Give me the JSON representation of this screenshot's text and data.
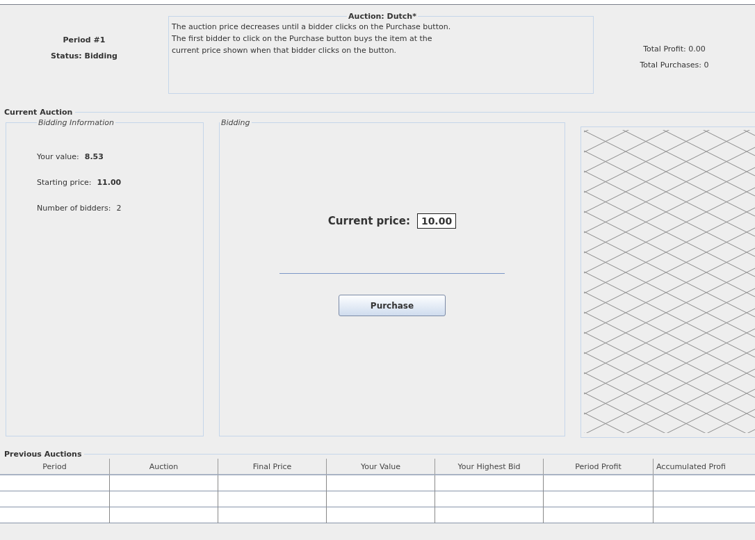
{
  "header": {
    "period": "Period #1",
    "status": "Status: Bidding"
  },
  "rules": {
    "title": "Auction: Dutch*",
    "text": "The auction price decreases until a bidder clicks on the Purchase button.\nThe first bidder to click on the Purchase button buys the item at the\ncurrent price shown when that bidder clicks on the button."
  },
  "totals": [
    "Total Profit: 0.00",
    "Total Purchases: 0"
  ],
  "current_auction": {
    "title": "Current Auction",
    "bidding_information": {
      "title": "Bidding Information",
      "items": [
        {
          "label": "Your value:",
          "value": "8.53",
          "bold": true
        },
        {
          "label": "Starting price:",
          "value": "11.00",
          "bold": true
        },
        {
          "label": "Number of bidders:",
          "value": "2",
          "bold": false
        }
      ]
    },
    "bidding": {
      "title": "Bidding",
      "price_label": "Current price:",
      "price": "10.00",
      "button": "Purchase"
    }
  },
  "previous_auctions": {
    "title": "Previous Auctions",
    "columns": [
      "Period",
      "Auction",
      "Final Price",
      "Your Value",
      "Your Highest Bid",
      "Period Profit",
      "Accumulated Profi"
    ]
  }
}
